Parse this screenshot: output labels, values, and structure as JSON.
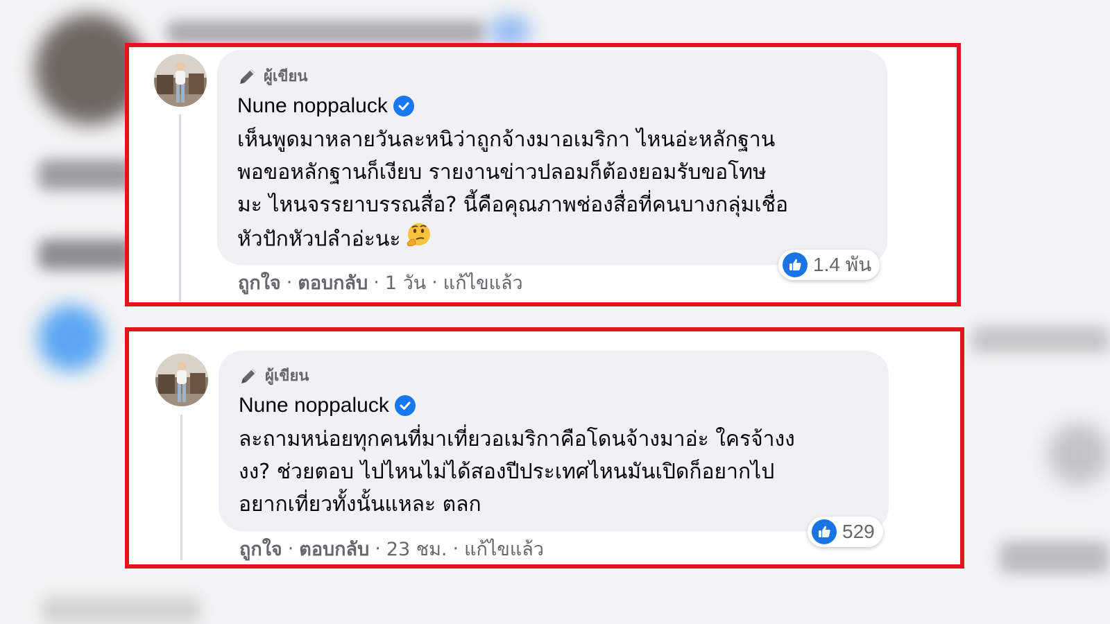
{
  "comments": [
    {
      "author_badge": "ผู้เขียน",
      "author_name": "Nune noppaluck",
      "verified": true,
      "text": "เห็นพูดมาหลายวันละหนิว่าถูกจ้างมาอเมริกา ไหนอ่ะหลักฐาน\nพอขอหลักฐานก็เงียบ รายงานข่าวปลอมก็ต้องยอมรับขอโทษ\nมะ ไหนจรรยาบรรณสื่อ? นี้คือคุณภาพช่องสื่อที่คนบางกลุ่มเชื่อ\nหัวปักหัวปลำอ่ะนะ",
      "emoji": "thinking-face",
      "reaction_count": "1.4 พัน",
      "actions": {
        "like": "ถูกใจ",
        "reply": "ตอบกลับ",
        "time": "1 วัน",
        "edited": "แก้ไขแล้ว"
      }
    },
    {
      "author_badge": "ผู้เขียน",
      "author_name": "Nune noppaluck",
      "verified": true,
      "text": "ละถามหน่อยทุกคนที่มาเที่ยวอเมริกาคือโดนจ้างมาอ่ะ ใครจ้างง\nงง? ช่วยตอบ ไปไหนไม่ได้สองปีประเทศไหนมันเปิดก็อยากไป\nอยากเที่ยวทั้งนั้นแหละ ตลก",
      "reaction_count": "529",
      "actions": {
        "like": "ถูกใจ",
        "reply": "ตอบกลับ",
        "time": "23 ชม.",
        "edited": "แก้ไขแล้ว"
      }
    }
  ],
  "colors": {
    "highlight_border": "#e5131c",
    "bubble": "#eff1f4",
    "verified": "#1877f2",
    "like": "#1b74e4",
    "muted_text": "#65676b"
  }
}
